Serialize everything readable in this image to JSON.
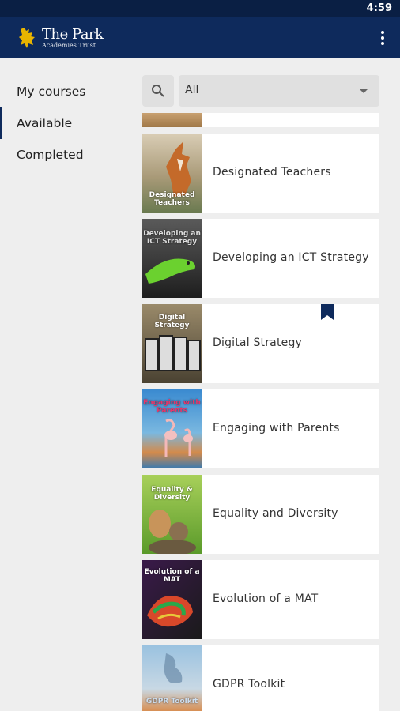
{
  "status": {
    "time": "4:59"
  },
  "header": {
    "logo_line1": "The Park",
    "logo_line2": "Academies Trust",
    "menu_icon": "more-vert-icon"
  },
  "sidebar": {
    "items": [
      {
        "label": "My courses",
        "active": false
      },
      {
        "label": "Available",
        "active": true
      },
      {
        "label": "Completed",
        "active": false
      }
    ]
  },
  "filter": {
    "search_icon": "search-icon",
    "selected": "All"
  },
  "courses": [
    {
      "title": "Designated Teachers",
      "thumb_text": "Designated Teachers",
      "thumb_colors": [
        "#b9a98a",
        "#6c7a58"
      ],
      "bookmarked": false
    },
    {
      "title": "Developing an ICT Strategy",
      "thumb_text": "Developing an ICT Strategy",
      "thumb_colors": [
        "#555555",
        "#222222"
      ],
      "bookmarked": false
    },
    {
      "title": "Digital Strategy",
      "thumb_text": "Digital Strategy",
      "thumb_colors": [
        "#8a7a5a",
        "#3a3a2a"
      ],
      "bookmarked": true
    },
    {
      "title": "Engaging with Parents",
      "thumb_text": "Engaging with Parents",
      "thumb_colors": [
        "#3a86c8",
        "#c98a4a"
      ],
      "bookmarked": false
    },
    {
      "title": "Equality and Diversity",
      "thumb_text": "Equality & Diversity",
      "thumb_colors": [
        "#8fbf4a",
        "#5a8a2a"
      ],
      "bookmarked": false
    },
    {
      "title": "Evolution of a MAT",
      "thumb_text": "Evolution of a MAT",
      "thumb_colors": [
        "#7a2a6a",
        "#2a8a3a"
      ],
      "bookmarked": false
    },
    {
      "title": "GDPR Toolkit",
      "thumb_text": "GDPR Toolkit",
      "thumb_colors": [
        "#8ab4d8",
        "#c8703a"
      ],
      "bookmarked": false
    }
  ],
  "colors": {
    "appbar": "#0e2a5c",
    "statusbar": "#0a1f44",
    "accent": "#0e2a5c"
  }
}
